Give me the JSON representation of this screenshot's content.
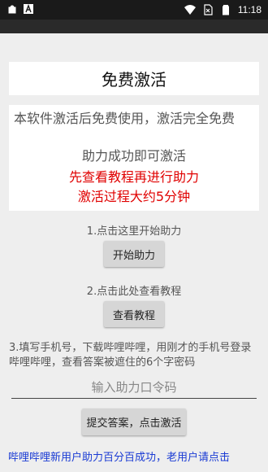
{
  "status_bar": {
    "time": "11:18",
    "left_icons": [
      "app-notification-icon",
      "a-notification-icon"
    ],
    "right_icons": [
      "wifi-icon",
      "no-sim-icon",
      "battery-icon"
    ]
  },
  "title": "免费激活",
  "info": {
    "description": "本软件激活后免费使用，激活完全免费",
    "line1": "助力成功即可激活",
    "line2": "先查看教程再进行助力",
    "line3": "激活过程大约5分钟",
    "accent_color": "#e00000"
  },
  "step1": {
    "label": "1.点击这里开始助力",
    "button": "开始助力"
  },
  "step2": {
    "label": "2.点击此处查看教程",
    "button": "查看教程"
  },
  "step3": {
    "text": "3.填写手机号，下载哔哩哔哩，用刚才的手机号登录哔哩哔哩，查看答案被遮住的6个字密码"
  },
  "code_input": {
    "placeholder": "输入助力口令码",
    "value": ""
  },
  "submit_button": "提交答案，点击激活",
  "bottom_link": "哔哩哔哩新用户助力百分百成功，老用户请点击"
}
